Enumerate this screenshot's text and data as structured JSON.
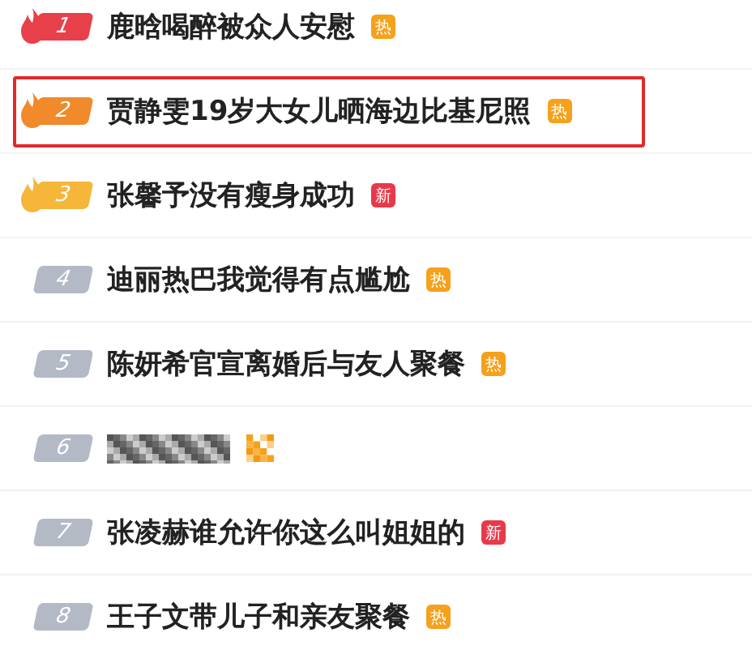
{
  "hot_list": [
    {
      "rank": "1",
      "color": "#e8404a",
      "flame": true,
      "title": "鹿晗喝醉被众人安慰",
      "tag": {
        "text": "热",
        "kind": "hot"
      },
      "highlighted": false,
      "obscured": false
    },
    {
      "rank": "2",
      "color": "#f08a2a",
      "flame": true,
      "title": "贾静雯19岁大女儿晒海边比基尼照",
      "tag": {
        "text": "热",
        "kind": "hot"
      },
      "highlighted": true,
      "obscured": false
    },
    {
      "rank": "3",
      "color": "#f5b63a",
      "flame": true,
      "title": "张馨予没有瘦身成功",
      "tag": {
        "text": "新",
        "kind": "new"
      },
      "highlighted": false,
      "obscured": false
    },
    {
      "rank": "4",
      "color": "#b4b9c6",
      "flame": false,
      "title": "迪丽热巴我觉得有点尴尬",
      "tag": {
        "text": "热",
        "kind": "hot"
      },
      "highlighted": false,
      "obscured": false
    },
    {
      "rank": "5",
      "color": "#b4b9c6",
      "flame": false,
      "title": "陈妍希官宣离婚后与友人聚餐",
      "tag": {
        "text": "热",
        "kind": "hot"
      },
      "highlighted": false,
      "obscured": false
    },
    {
      "rank": "6",
      "color": "#b4b9c6",
      "flame": false,
      "highlighted": false,
      "obscured": true
    },
    {
      "rank": "7",
      "color": "#b4b9c6",
      "flame": false,
      "title": "张凌赫谁允许你这么叫姐姐的",
      "tag": {
        "text": "新",
        "kind": "new"
      },
      "highlighted": false,
      "obscured": false
    },
    {
      "rank": "8",
      "color": "#b4b9c6",
      "flame": false,
      "title": "王子文带儿子和亲友聚餐",
      "tag": {
        "text": "热",
        "kind": "hot"
      },
      "highlighted": false,
      "obscured": false
    }
  ]
}
